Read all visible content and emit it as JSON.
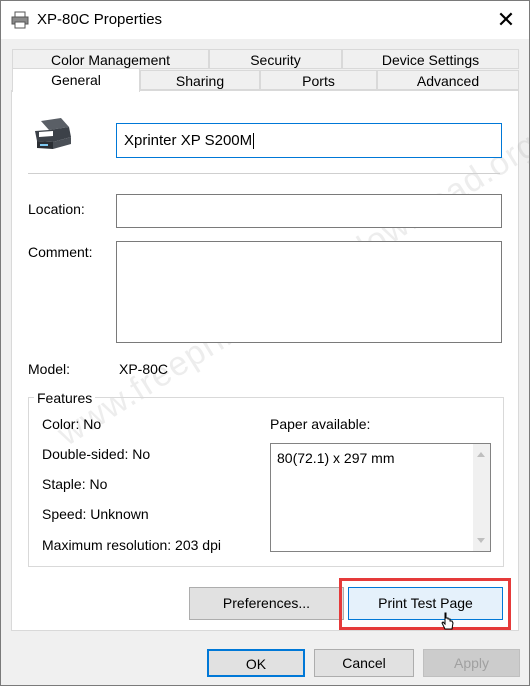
{
  "window": {
    "title": "XP-80C Properties"
  },
  "tabs_top": [
    "Color Management",
    "Security",
    "Device Settings"
  ],
  "tabs_bottom": [
    "General",
    "Sharing",
    "Ports",
    "Advanced"
  ],
  "general": {
    "printer_name": "Xprinter XP S200M",
    "location_label": "Location:",
    "location_value": "",
    "comment_label": "Comment:",
    "comment_value": "",
    "model_label": "Model:",
    "model_value": "XP-80C"
  },
  "features": {
    "legend": "Features",
    "color": "Color: No",
    "double_sided": "Double-sided: No",
    "staple": "Staple: No",
    "speed": "Speed: Unknown",
    "max_resolution": "Maximum resolution: 203 dpi",
    "paper_label": "Paper available:",
    "paper_items": [
      "80(72.1) x 297 mm"
    ]
  },
  "buttons": {
    "preferences": "Preferences...",
    "print_test": "Print Test Page",
    "ok": "OK",
    "cancel": "Cancel",
    "apply": "Apply"
  },
  "watermark": "www.freeprinterdriverdownload.org",
  "colors": {
    "accent": "#0078d7",
    "highlight": "#e53a3a"
  }
}
